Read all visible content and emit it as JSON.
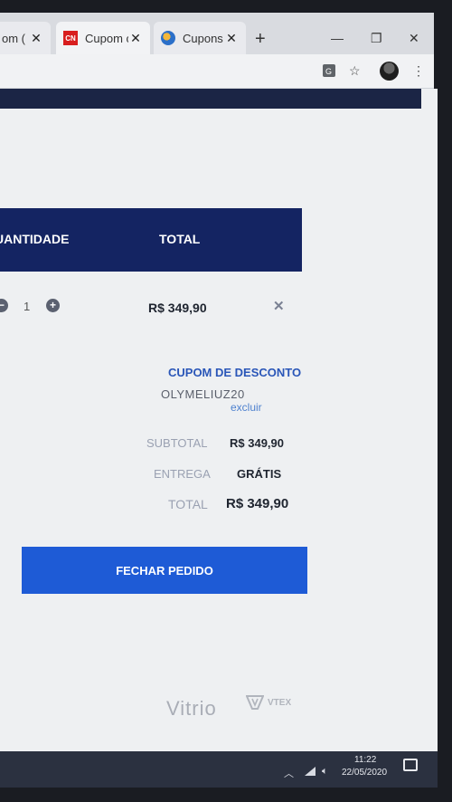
{
  "browser": {
    "tabs": [
      {
        "title": "om (",
        "close": "✕"
      },
      {
        "title": "Cupom c",
        "favicon_text": "CN",
        "close": "✕"
      },
      {
        "title": "Cupons",
        "close": "✕"
      }
    ],
    "new_tab": "+",
    "window": {
      "minimize": "—",
      "restore": "❐",
      "close": "✕"
    }
  },
  "cart": {
    "headers": {
      "quantity": "UANTIDADE",
      "total": "TOTAL"
    },
    "item": {
      "minus": "−",
      "quantity": "1",
      "plus": "+",
      "total": "R$ 349,90",
      "remove": "✕"
    }
  },
  "coupon": {
    "title": "CUPOM DE DESCONTO",
    "code": "OLYMELIUZ20",
    "remove_link": "excluir"
  },
  "summary": {
    "subtotal_label": "SUBTOTAL",
    "subtotal_value": "R$ 349,90",
    "delivery_label": "ENTREGA",
    "delivery_value": "GRÁTIS",
    "total_label": "TOTAL",
    "total_value": "R$ 349,90"
  },
  "checkout_button": "FECHAR PEDIDO",
  "footer": {
    "brand1": "Vitrio",
    "brand2": "VTEX"
  },
  "taskbar": {
    "time": "11:22",
    "date": "22/05/2020"
  }
}
